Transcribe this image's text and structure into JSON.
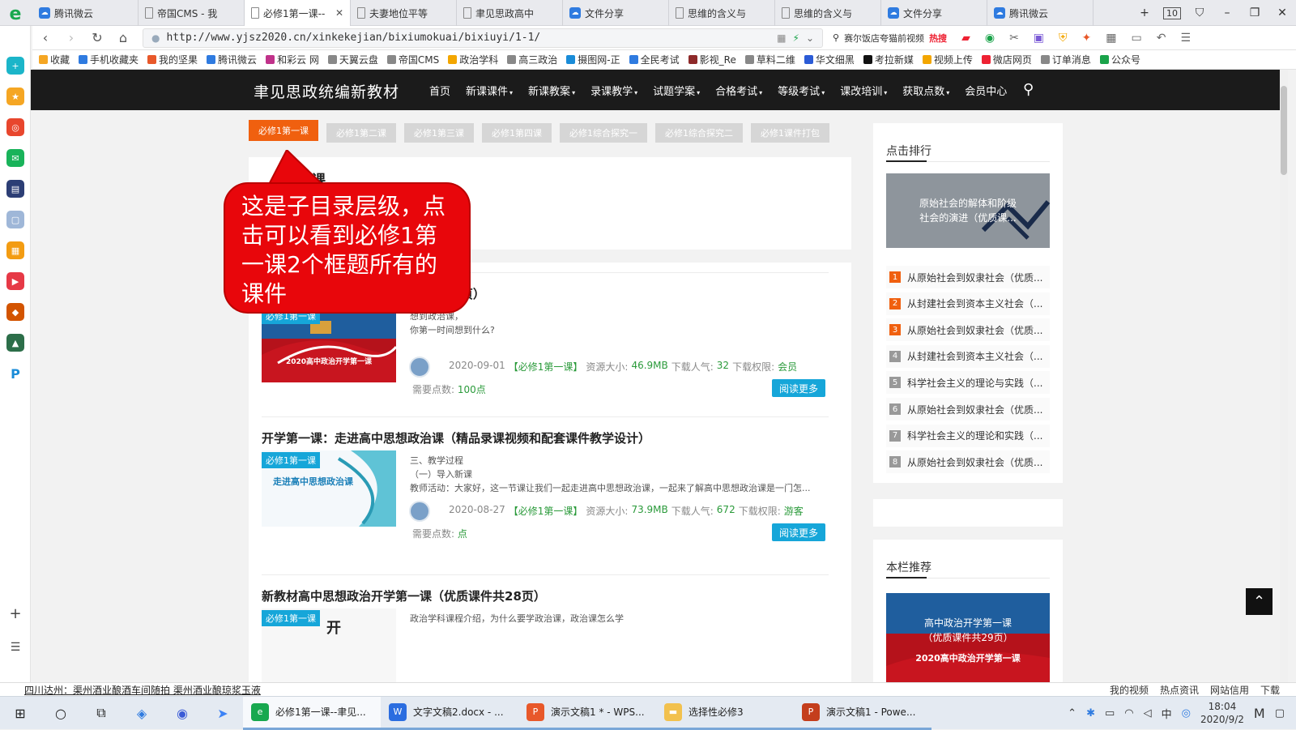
{
  "browser": {
    "tabs": [
      {
        "title": "腾讯微云",
        "icon": "cloud",
        "active": false
      },
      {
        "title": "帝国CMS - 我",
        "icon": "page",
        "active": false
      },
      {
        "title": "必修1第一课--",
        "icon": "page",
        "active": true
      },
      {
        "title": "夫妻地位平等",
        "icon": "page",
        "active": false
      },
      {
        "title": "聿见思政高中",
        "icon": "page",
        "active": false
      },
      {
        "title": "文件分享",
        "icon": "cloud",
        "active": false
      },
      {
        "title": "思维的含义与",
        "icon": "page",
        "active": false
      },
      {
        "title": "思维的含义与",
        "icon": "page",
        "active": false
      },
      {
        "title": "文件分享",
        "icon": "cloud",
        "active": false
      },
      {
        "title": "腾讯微云",
        "icon": "cloud",
        "active": false
      }
    ],
    "tab_count": "10",
    "url": "http://www.yjsz2020.cn/xinkekejian/bixiumokuai/bixiuyi/1-1/",
    "search_hint": "赛尔饭店夸猫前视频",
    "search_hot": "热搜",
    "bookmarks": [
      "收藏",
      "手机收藏夹",
      "我的坚果",
      "腾讯微云",
      "和彩云 网",
      "天翼云盘",
      "帝国CMS",
      "政治学科",
      "高三政治",
      "摄图网-正",
      "全民考试",
      "影视_Re",
      "草料二维",
      "华文细黑",
      "考拉新媒",
      "视频上传",
      "微店网页",
      "订单消息",
      "公众号"
    ]
  },
  "site": {
    "logo": "聿见思政统编新教材",
    "menu": [
      {
        "label": "首页",
        "arrow": ""
      },
      {
        "label": "新课课件",
        "arrow": "▾"
      },
      {
        "label": "新课教案",
        "arrow": "▾"
      },
      {
        "label": "录课教学",
        "arrow": "▾"
      },
      {
        "label": "试题学案",
        "arrow": "▾"
      },
      {
        "label": "合格考试",
        "arrow": "▾"
      },
      {
        "label": "等级考试",
        "arrow": "▾"
      },
      {
        "label": "课改培训",
        "arrow": "▾"
      },
      {
        "label": "获取点数",
        "arrow": "▾"
      },
      {
        "label": "会员中心",
        "arrow": ""
      }
    ],
    "subtabs": [
      "必修1第一课",
      "必修1第二课",
      "必修1第三课",
      "必修1第四课",
      "必修1综合探究一",
      "必修1综合探究二",
      "必修1课件打包"
    ],
    "intro_title": "第一课",
    "intro_sub": "展",
    "articles": [
      {
        "title": "高中政治开学第一课（优质课件共29页）",
        "badge": "必修1第一课",
        "thumb_caption": "2020高中政治开学第一课",
        "excerpt": "想到政治课，\n你第一时间想到什么?",
        "date": "2020-09-01",
        "category": "【必修1第一课】",
        "size_label": "资源大小:",
        "size": "46.9MB",
        "downloads_label": "下载人气:",
        "downloads": "32",
        "perm_label": "下载权限:",
        "perm": "会员",
        "points_label": "需要点数:",
        "points": "100点",
        "button": "阅读更多"
      },
      {
        "title": "开学第一课：走进高中思想政治课（精品录课视频和配套课件教学设计）",
        "badge": "必修1第一课",
        "thumb_caption": "走进高中思想政治课",
        "excerpt": "三、教学过程\n（一）导入新课\n教师活动：大家好，这一节课让我们一起走进高中思想政治课，一起来了解高中思想政治课是一门怎...",
        "date": "2020-08-27",
        "category": "【必修1第一课】",
        "size_label": "资源大小:",
        "size": "73.9MB",
        "downloads_label": "下载人气:",
        "downloads": "672",
        "perm_label": "下载权限:",
        "perm": "游客",
        "points_label": "需要点数:",
        "points": "点",
        "button": "阅读更多"
      },
      {
        "title": "新教材高中思想政治开学第一课（优质课件共28页）",
        "badge": "必修1第一课",
        "thumb_caption": "开",
        "excerpt": "政治学科课程介绍，为什么要学政治课，政治课怎么学",
        "date": "",
        "category": "",
        "size_label": "",
        "size": "",
        "downloads_label": "",
        "downloads": "",
        "perm_label": "",
        "perm": "",
        "points_label": "",
        "points": "",
        "button": ""
      }
    ],
    "sidebar": {
      "ranking_title": "点击排行",
      "feature_text": "原始社会的解体和阶级\n社会的演进（优质课...",
      "ranking": [
        "从原始社会到奴隶社会（优质...",
        "从封建社会到资本主义社会（...",
        "从原始社会到奴隶社会（优质...",
        "从封建社会到资本主义社会（...",
        "科学社会主义的理论与实践（...",
        "从原始社会到奴隶社会（优质...",
        "科学社会主义的理论和实践（...",
        "从原始社会到奴隶社会（优质..."
      ],
      "recommend_title": "本栏推荐",
      "recommend_text": "高中政治开学第一课\n（优质课件共29页）",
      "recommend_caption": "2020高中政治开学第一课"
    }
  },
  "callout": "这是子目录层级，点击可以看到必修1第一课2个框题所有的课件",
  "statusbar": {
    "news": "四川达州：渠州酒业酿酒车间随拍 渠州酒业酿琼浆玉液",
    "items": [
      "我的视频",
      "热点资讯",
      "网站信用",
      "下载"
    ]
  },
  "taskbar": {
    "apps": [
      {
        "label": "必修1第一课--聿见...",
        "color": "#18a84f",
        "glyph": "e",
        "active": true
      },
      {
        "label": "文字文稿2.docx - ...",
        "color": "#2b6de0",
        "glyph": "W",
        "active": false
      },
      {
        "label": "演示文稿1 * - WPS...",
        "color": "#e8582a",
        "glyph": "P",
        "active": false
      },
      {
        "label": "选择性必修3",
        "color": "#f2c14e",
        "glyph": "▬",
        "active": false
      },
      {
        "label": "演示文稿1 - Powe...",
        "color": "#c43e1c",
        "glyph": "P",
        "active": false
      }
    ],
    "time": "18:04",
    "date": "2020/9/2"
  },
  "colors": {
    "accent": "#f0600f",
    "blue": "#16a6d9",
    "callout": "#e8060b",
    "nav": "#1b1b1b"
  }
}
